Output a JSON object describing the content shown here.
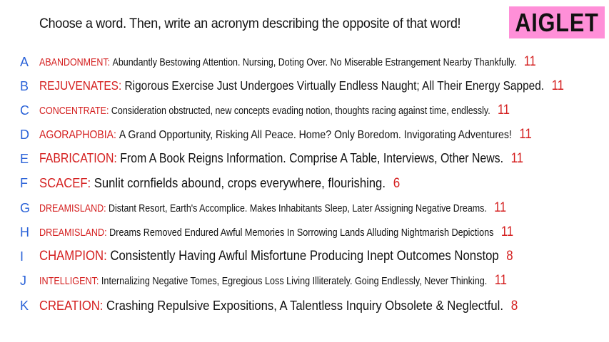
{
  "prompt": "Choose a word. Then, write an acronym describing the opposite of that word!",
  "logo": "AIGLET",
  "colors": {
    "letter": "#2a62d8",
    "word": "#d41e1e",
    "count": "#d41e1e",
    "logo_bg": "#ff8fd8"
  },
  "entries": [
    {
      "letter": "A",
      "word": "ABANDONMENT:",
      "definition": "Abundantly Bestowing Attention. Nursing, Doting Over. No Miserable Estrangement Nearby Thankfully.",
      "count": "11"
    },
    {
      "letter": "B",
      "word": "REJUVENATES:",
      "definition": "Rigorous Exercise Just Undergoes Virtually Endless Naught; All Their Energy Sapped.",
      "count": "11"
    },
    {
      "letter": "C",
      "word": "CONCENTRATE:",
      "definition": "Consideration obstructed, new concepts evading notion, thoughts racing against time, endlessly.",
      "count": "11"
    },
    {
      "letter": "D",
      "word": "AGORAPHOBIA:",
      "definition": "A Grand Opportunity, Risking All Peace. Home? Only Boredom. Invigorating Adventures!",
      "count": "11"
    },
    {
      "letter": "E",
      "word": "FABRICATION:",
      "definition": "From A Book Reigns Information. Comprise A Table, Interviews, Other News.",
      "count": "11"
    },
    {
      "letter": "F",
      "word": "SCACEF:",
      "definition": "Sunlit cornfields abound, crops everywhere, flourishing.",
      "count": "6"
    },
    {
      "letter": "G",
      "word": "DREAMISLAND:",
      "definition": "Distant Resort, Earth's Accomplice. Makes Inhabitants Sleep, Later Assigning Negative Dreams.",
      "count": "11"
    },
    {
      "letter": "H",
      "word": "DREAMISLAND:",
      "definition": "Dreams Removed Endured Awful Memories In Sorrowing Lands Alluding Nightmarish Depictions",
      "count": "11"
    },
    {
      "letter": "I",
      "word": "CHAMPION:",
      "definition": "Consistently Having Awful Misfortune Producing Inept Outcomes Nonstop",
      "count": "8"
    },
    {
      "letter": "J",
      "word": "INTELLIGENT:",
      "definition": "Internalizing Negative Tomes, Egregious Loss Living Illiterately. Going Endlessly, Never Thinking.",
      "count": "11"
    },
    {
      "letter": "K",
      "word": "CREATION:",
      "definition": "Crashing Repulsive Expositions, A Talentless Inquiry Obsolete & Neglectful.",
      "count": "8"
    }
  ]
}
